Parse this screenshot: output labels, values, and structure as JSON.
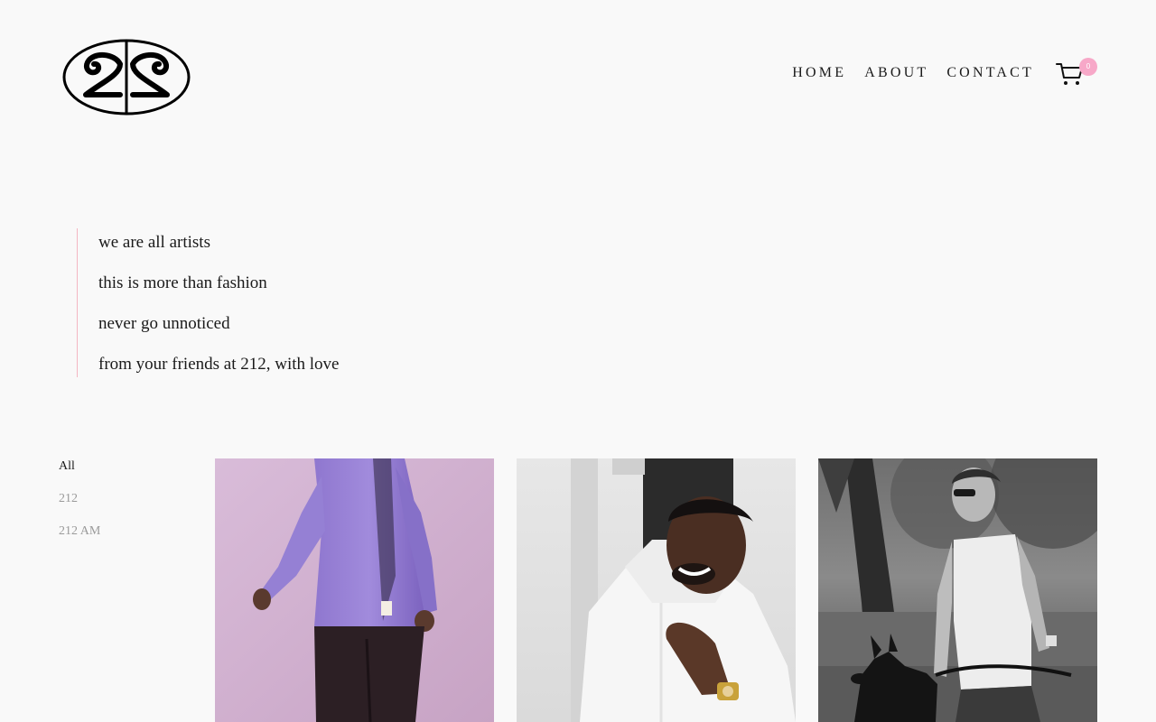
{
  "brand": {
    "logo_alt": "212"
  },
  "nav": {
    "items": [
      {
        "label": "HOME"
      },
      {
        "label": "ABOUT"
      },
      {
        "label": "CONTACT"
      }
    ]
  },
  "cart": {
    "count": "0",
    "badge_color": "#f7a8c8"
  },
  "quote": {
    "lines": [
      "we are all artists",
      "this is more than fashion",
      "never go unnoticed",
      "from your friends at 212, with love"
    ],
    "accent_color": "#f4b6c2"
  },
  "filters": {
    "items": [
      {
        "label": "All",
        "active": true
      },
      {
        "label": "212",
        "active": false
      },
      {
        "label": "212 AM",
        "active": false
      }
    ]
  },
  "gallery": {
    "items": [
      {
        "subject": "model in lavender long-sleeve shirt against pink wall"
      },
      {
        "subject": "smiling man in white hoodie with gold watch"
      },
      {
        "subject": "man in white tank top walking a dog, black and white"
      }
    ]
  }
}
